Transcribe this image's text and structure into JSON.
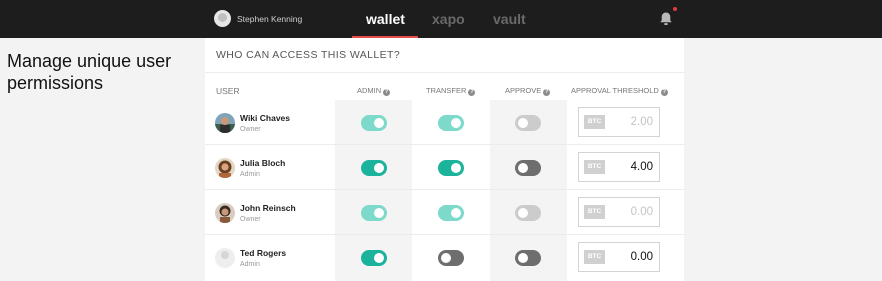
{
  "header": {
    "user_name": "Stephen Kenning",
    "tabs": [
      {
        "label": "wallet",
        "active": true
      },
      {
        "label": "xapo",
        "active": false
      },
      {
        "label": "vault",
        "active": false
      }
    ],
    "notification_dot_color": "#e33a3a",
    "accent_color": "#e94b4b"
  },
  "side_caption": "Manage unique user permissions",
  "panel": {
    "title": "WHO CAN ACCESS THIS WALLET?",
    "columns": {
      "user": "USER",
      "admin": "ADMIN",
      "transfer": "TRANSFER",
      "approve": "APPROVE",
      "threshold": "APPROVAL THRESHOLD"
    },
    "currency_badge": "BTC",
    "rows": [
      {
        "name": "Wiki Chaves",
        "role": "Owner",
        "admin": true,
        "transfer": true,
        "approve": false,
        "threshold": "2.00",
        "editable": false
      },
      {
        "name": "Julia Bloch",
        "role": "Admin",
        "admin": true,
        "transfer": true,
        "approve": false,
        "threshold": "4.00",
        "editable": true
      },
      {
        "name": "John Reinsch",
        "role": "Owner",
        "admin": true,
        "transfer": true,
        "approve": false,
        "threshold": "0.00",
        "editable": false
      },
      {
        "name": "Ted Rogers",
        "role": "Admin",
        "admin": true,
        "transfer": false,
        "approve": false,
        "threshold": "0.00",
        "editable": true
      }
    ]
  },
  "colors": {
    "toggle_on": "#1bb39c",
    "toggle_on_disabled": "#7dd9ca",
    "toggle_off": "#6e6e6e",
    "toggle_off_disabled": "#cccccc"
  }
}
